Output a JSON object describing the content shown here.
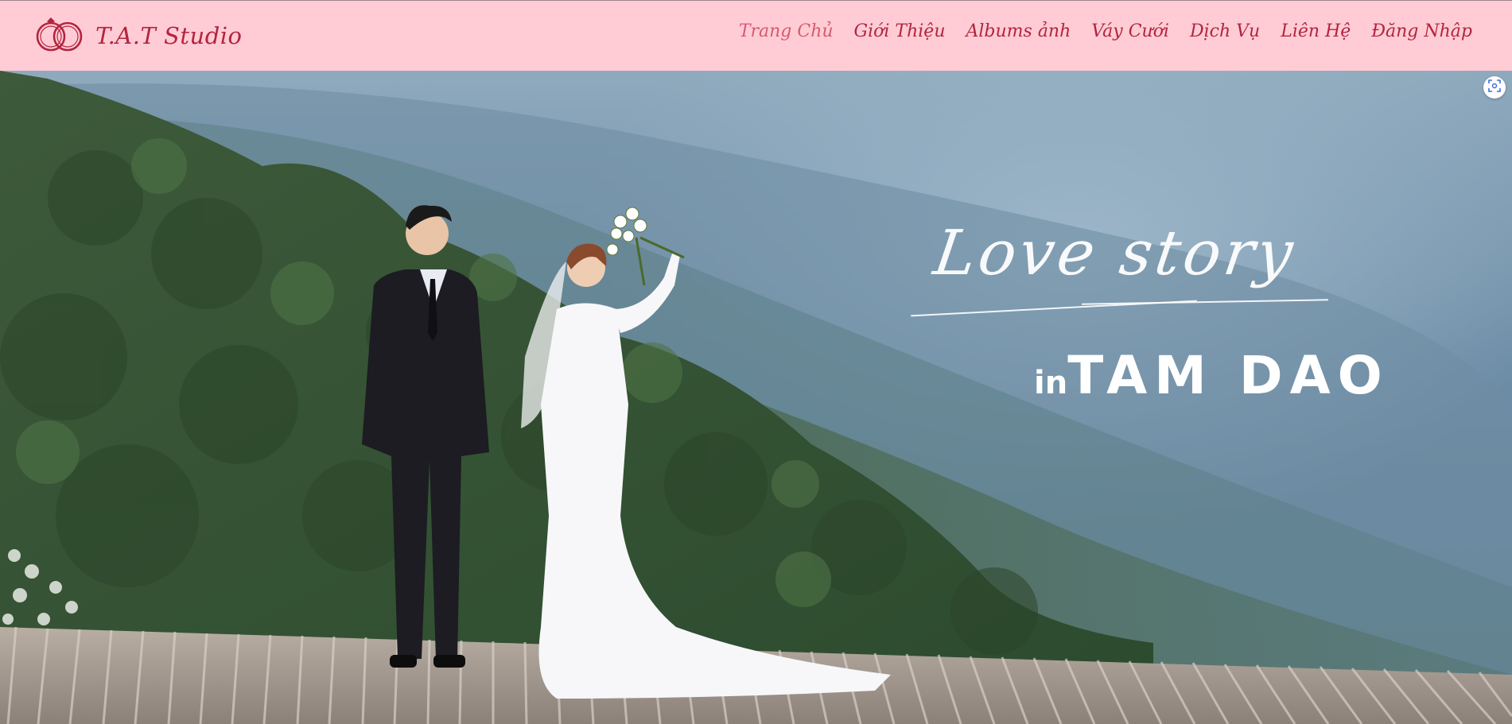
{
  "brand": {
    "name": "T.A.T Studio",
    "logo_icon": "wedding-rings-icon"
  },
  "nav": {
    "items": [
      {
        "label": "Trang Chủ",
        "active": true
      },
      {
        "label": "Giới Thiệu",
        "active": false
      },
      {
        "label": "Albums ảnh",
        "active": false
      },
      {
        "label": "Váy Cưới",
        "active": false
      },
      {
        "label": "Dịch Vụ",
        "active": false
      },
      {
        "label": "Liên Hệ",
        "active": false
      },
      {
        "label": "Đăng Nhập",
        "active": false
      }
    ]
  },
  "hero": {
    "script_text": "Love story",
    "in_text": "in",
    "place_text": "TAM DAO",
    "scan_icon": "screen-capture-icon"
  },
  "colors": {
    "header_bg": "#ffccd5",
    "brand": "#b3243f",
    "nav_active": "#d65a6f"
  }
}
